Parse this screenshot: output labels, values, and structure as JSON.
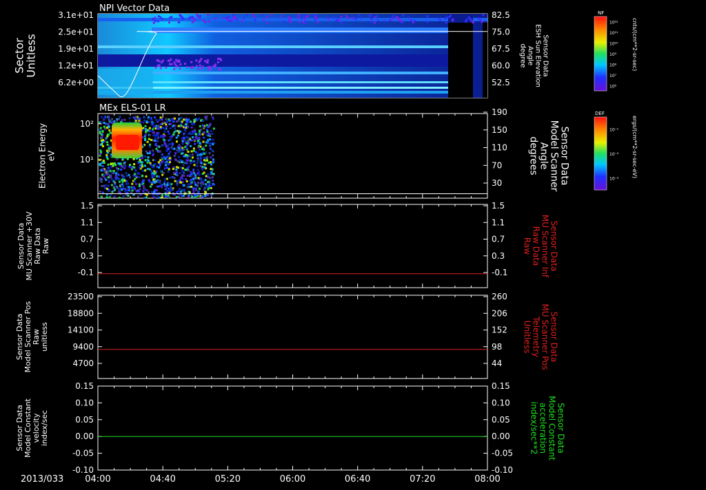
{
  "date_label": "2013/033",
  "time_ticks": [
    "04:00",
    "04:40",
    "05:20",
    "06:00",
    "06:40",
    "07:20",
    "08:00"
  ],
  "colorbars": [
    {
      "corner_label": "NF",
      "unit": "cnts/(cm**2-sr-sec)",
      "ticks": [
        "10¹²",
        "10¹¹",
        "10¹⁰",
        "10⁹",
        "10⁸",
        "10⁷",
        "10⁶"
      ]
    },
    {
      "corner_label": "DEF",
      "unit": "ergs/(cm**2-sr-sec-eV)",
      "ticks": [
        "10⁻¹",
        "10⁻²",
        "10⁻³"
      ]
    }
  ],
  "panels": [
    {
      "title": "NPI Vector Data",
      "left_label": [
        "Sector",
        "Unitless"
      ],
      "right_label": [
        "Sensor Data",
        "ESH Sun Elevation",
        "Angle",
        "degree"
      ],
      "left_ticks": [
        "3.1e+01",
        "2.5e+01",
        "1.9e+01",
        "1.2e+01",
        "6.2e+00"
      ],
      "right_ticks": [
        "82.5",
        "75.0",
        "67.5",
        "60.0",
        "52.5"
      ]
    },
    {
      "title": "MEx ELS-01 LR",
      "left_label": [
        "Electron Energy",
        "eV"
      ],
      "right_label": [
        "Sensor Data",
        "Model Scanner",
        "Angle",
        "degrees"
      ],
      "left_ticks": [
        "10²",
        "10¹"
      ],
      "right_ticks": [
        "190",
        "150",
        "110",
        "70",
        "30"
      ]
    },
    {
      "title": "",
      "left_label": [
        "Sensor Data",
        "MU Scanner +30V",
        "Raw Data",
        "Raw"
      ],
      "right_label": [
        "Sensor Data",
        "MU Scanner Inf",
        "Raw Data",
        "Raw"
      ],
      "left_ticks": [
        "1.5",
        "1.1",
        "0.7",
        "0.3",
        "-0.1"
      ],
      "right_ticks": [
        "1.5",
        "1.1",
        "0.7",
        "0.3",
        "-0.1"
      ]
    },
    {
      "title": "",
      "left_label": [
        "Sensor Data",
        "Model Scanner Pos",
        "Raw",
        "unitless"
      ],
      "right_label": [
        "Sensor Data",
        "MU Scanner Pos",
        "Telemetry",
        "Unitless"
      ],
      "left_ticks": [
        "23500",
        "18800",
        "14100",
        "9400",
        "4700"
      ],
      "right_ticks": [
        "260",
        "206",
        "152",
        "98",
        "44"
      ]
    },
    {
      "title": "",
      "left_label": [
        "Sensor Data",
        "Model Constant",
        "velocity",
        "index/sec"
      ],
      "right_label": [
        "Sensor Data",
        "Model Constant",
        "acceleration",
        "index/sec**2"
      ],
      "left_ticks": [
        "0.15",
        "0.10",
        "0.05",
        "0.00",
        "-0.05",
        "-0.10"
      ],
      "right_ticks": [
        "0.15",
        "0.10",
        "0.05",
        "0.00",
        "-0.05",
        "-0.10"
      ]
    }
  ],
  "colors": {
    "white": "#ffffff",
    "red": "#e02020",
    "green": "#20e020",
    "background": "#000000"
  },
  "chart_data": [
    {
      "type": "heatmap",
      "title": "NPI Vector Data",
      "xlabel": "",
      "ylabel": "Sector Unitless",
      "x_range": [
        "04:00",
        "08:00"
      ],
      "y_ticks": [
        "3.1e+01",
        "2.5e+01",
        "1.9e+01",
        "1.2e+01",
        "6.2e+00"
      ],
      "overlay_series": {
        "name": "ESH Sun Elevation Angle",
        "y_units": "degree",
        "y_range": [
          47,
          85
        ],
        "points": [
          {
            "t": "04:00",
            "y": 57
          },
          {
            "t": "04:10",
            "y": 50
          },
          {
            "t": "04:15",
            "y": 47.5
          },
          {
            "t": "04:20",
            "y": 52
          },
          {
            "t": "04:30",
            "y": 68
          },
          {
            "t": "04:36",
            "y": 76
          },
          {
            "t": "04:40",
            "y": 77
          },
          {
            "t": "08:00",
            "y": 77
          }
        ]
      }
    },
    {
      "type": "heatmap",
      "title": "MEx ELS-01 LR",
      "xlabel": "",
      "ylabel": "Electron Energy eV",
      "x_range": [
        "04:00",
        "08:00"
      ],
      "y_scale": "log",
      "data_extent": [
        "04:00",
        "05:05"
      ],
      "overlay_series": {
        "name": "Model Scanner Angle",
        "y_units": "degrees",
        "y_range": [
          0,
          190
        ],
        "points": [
          {
            "t": "04:00",
            "y": 10
          },
          {
            "t": "08:00",
            "y": 10
          }
        ]
      }
    },
    {
      "type": "line",
      "xlabel": "",
      "ylabel": "MU Scanner +30V Raw",
      "y_range": [
        -0.3,
        1.5
      ],
      "series": [
        {
          "name": "MU Scanner Inf Raw Data",
          "color": "#e02020",
          "points": [
            {
              "t": "04:00",
              "y": 0.0
            },
            {
              "t": "08:00",
              "y": 0.0
            }
          ]
        }
      ]
    },
    {
      "type": "line",
      "xlabel": "",
      "ylabel": "Model Scanner Pos unitless",
      "y_range": [
        0,
        23500
      ],
      "series": [
        {
          "name": "MU Scanner Pos Telemetry",
          "color": "#e02020",
          "points": [
            {
              "t": "04:00",
              "y": 8200
            },
            {
              "t": "08:00",
              "y": 8200
            }
          ]
        }
      ]
    },
    {
      "type": "line",
      "xlabel": "",
      "ylabel": "Model Constant velocity index/sec",
      "y_range": [
        -0.1,
        0.15
      ],
      "series": [
        {
          "name": "Model Constant acceleration",
          "color": "#20e020",
          "points": [
            {
              "t": "04:00",
              "y": 0.0
            },
            {
              "t": "08:00",
              "y": 0.0
            }
          ]
        }
      ]
    }
  ]
}
